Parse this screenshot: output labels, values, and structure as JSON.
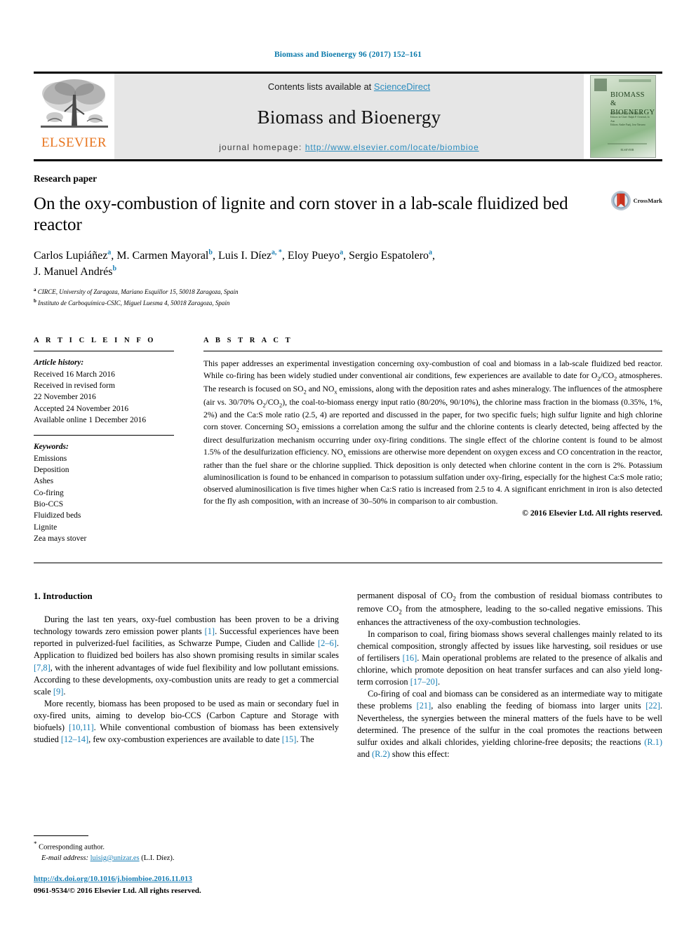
{
  "running_head": "Biomass and Bioenergy 96 (2017) 152–161",
  "masthead": {
    "publisher_logo_text": "ELSEVIER",
    "contents_prefix": "Contents lists available at ",
    "contents_link": "ScienceDirect",
    "journal_title": "Biomass and Bioenergy",
    "homepage_prefix": "journal homepage: ",
    "homepage_url": "http://www.elsevier.com/locate/biombioe",
    "cover": {
      "title_line1": "BIOMASS &",
      "title_line2": "BIOENERGY",
      "sub_line1": "ISSN 0961-9534 VOLUME 96",
      "sub_line2": "Editors-in-Chief: Ralph P. Overend, Jo Ann",
      "sub_line3": "Editors: Andre Faaij, Jose Navarro",
      "bottom_text": "ELSEVIER"
    }
  },
  "article": {
    "type": "Research paper",
    "title": "On the oxy-combustion of lignite and corn stover in a lab-scale fluidized bed reactor",
    "crossmark_label": "CrossMark",
    "authors_line1_a": "Carlos Lupiáñez",
    "authors_line1_b": "M. Carmen Mayoral",
    "authors_line1_c": "Luis I. Díez",
    "authors_line1_d": "Eloy Pueyo",
    "authors_line1_e": "Sergio Espatolero",
    "authors_line2_a": "J. Manuel Andrés",
    "affiliation_a": "CIRCE, University of Zaragoza, Mariano Esquillor 15, 50018 Zaragoza, Spain",
    "affiliation_b": "Instituto de Carboquímica-CSIC, Miguel Luesma 4, 50018 Zaragoza, Spain"
  },
  "article_info": {
    "heading": "A R T I C L E   I N F O",
    "history_label": "Article history:",
    "history": [
      "Received 16 March 2016",
      "Received in revised form",
      "22 November 2016",
      "Accepted 24 November 2016",
      "Available online 1 December 2016"
    ],
    "keywords_label": "Keywords:",
    "keywords": [
      "Emissions",
      "Deposition",
      "Ashes",
      "Co-firing",
      "Bio-CCS",
      "Fluidized beds",
      "Lignite",
      "Zea mays stover"
    ]
  },
  "abstract": {
    "heading": "A B S T R A C T",
    "paragraph_1": "This paper addresses an experimental investigation concerning oxy-combustion of coal and biomass in a lab-scale fluidized bed reactor. While co-firing has been widely studied under conventional air conditions, few experiences are available to date for O",
    "paragraph_2": " atmospheres. The research is focused on SO",
    "paragraph_3": " and NO",
    "paragraph_4": " emissions, along with the deposition rates and ashes mineralogy. The influences of the atmosphere (air vs. 30/70% O",
    "paragraph_5": "), the coal-to-biomass energy input ratio (80/20%, 90/10%), the chlorine mass fraction in the biomass (0.35%, 1%, 2%) and the Ca:S mole ratio (2.5, 4) are reported and discussed in the paper, for two specific fuels; high sulfur lignite and high chlorine corn stover. Concerning SO",
    "paragraph_6": " emissions a correlation among the sulfur and the chlorine contents is clearly detected, being affected by the direct desulfurization mechanism occurring under oxy-firing conditions. The single effect of the chlorine content is found to be almost 1.5% of the desulfurization efficiency. NO",
    "paragraph_7": " emissions are otherwise more dependent on oxygen excess and CO concentration in the reactor, rather than the fuel share or the chlorine supplied. Thick deposition is only detected when chlorine content in the corn is 2%. Potassium aluminosilication is found to be enhanced in comparison to potassium sulfation under oxy-firing, especially for the highest Ca:S mole ratio; observed aluminosilication is five times higher when Ca:S ratio is increased from 2.5 to 4. A significant enrichment in iron is also detected for the fly ash composition, with an increase of 30–50% in comparison to air combustion.",
    "copyright": "© 2016 Elsevier Ltd. All rights reserved."
  },
  "introduction": {
    "section_title": "1. Introduction",
    "left_para_1_pre": "During the last ten years, oxy-fuel combustion has been proven to be a driving technology towards zero emission power plants ",
    "left_para_1_ref1": "[1]",
    "left_para_1_mid1": ". Successful experiences have been reported in pulverized-fuel facilities, as Schwarze Pumpe, Ciuden and Callide ",
    "left_para_1_ref2": "[2–6]",
    "left_para_1_mid2": ". Application to fluidized bed boilers has also shown promising results in similar scales ",
    "left_para_1_ref3": "[7,8]",
    "left_para_1_mid3": ", with the inherent advantages of wide fuel flexibility and low pollutant emissions. According to these developments, oxy-combustion units are ready to get a commercial scale ",
    "left_para_1_ref4": "[9]",
    "left_para_1_end": ".",
    "left_para_2_pre": "More recently, biomass has been proposed to be used as main or secondary fuel in oxy-fired units, aiming to develop bio-CCS (Carbon Capture and Storage with biofuels) ",
    "left_para_2_ref1": "[10,11]",
    "left_para_2_mid1": ". While conventional combustion of biomass has been extensively studied ",
    "left_para_2_ref2": "[12–14]",
    "left_para_2_mid2": ", few oxy-combustion experiences are available to date ",
    "left_para_2_ref3": "[15]",
    "left_para_2_end": ". The",
    "right_para_1_a": "permanent disposal of CO",
    "right_para_1_b": " from the combustion of residual biomass contributes to remove CO",
    "right_para_1_c": " from the atmosphere, leading to the so-called negative emissions. This enhances the attractiveness of the oxy-combustion technologies.",
    "right_para_2_pre": "In comparison to coal, firing biomass shows several challenges mainly related to its chemical composition, strongly affected by issues like harvesting, soil residues or use of fertilisers ",
    "right_para_2_ref1": "[16]",
    "right_para_2_mid1": ". Main operational problems are related to the presence of alkalis and chlorine, which promote deposition on heat transfer surfaces and can also yield long-term corrosion ",
    "right_para_2_ref2": "[17–20]",
    "right_para_2_end": ".",
    "right_para_3_pre": "Co-firing of coal and biomass can be considered as an intermediate way to mitigate these problems ",
    "right_para_3_ref1": "[21]",
    "right_para_3_mid1": ", also enabling the feeding of biomass into larger units ",
    "right_para_3_ref2": "[22]",
    "right_para_3_mid2": ". Nevertheless, the synergies between the mineral matters of the fuels have to be well determined. The presence of the sulfur in the coal promotes the reactions between sulfur oxides and alkali chlorides, yielding chlorine-free deposits; the reactions ",
    "right_para_3_ref3": "(R.1)",
    "right_para_3_mid3": " and ",
    "right_para_3_ref4": "(R.2)",
    "right_para_3_end": " show this effect:"
  },
  "footnote": {
    "star": "*",
    "corresponding": "Corresponding author.",
    "email_label": "E-mail address: ",
    "email": "luisig@unizar.es",
    "email_suffix": " (L.I. Díez)."
  },
  "footer": {
    "doi": "http://dx.doi.org/10.1016/j.biombioe.2016.11.013",
    "issn_line": "0961-9534/© 2016 Elsevier Ltd. All rights reserved."
  },
  "colors": {
    "link_blue": "#1a7fb5",
    "science_direct_blue": "#2b8cbe",
    "elsevier_orange": "#e87722",
    "crossmark_red": "#c8311e",
    "crossmark_blue": "#7f9cb5"
  }
}
